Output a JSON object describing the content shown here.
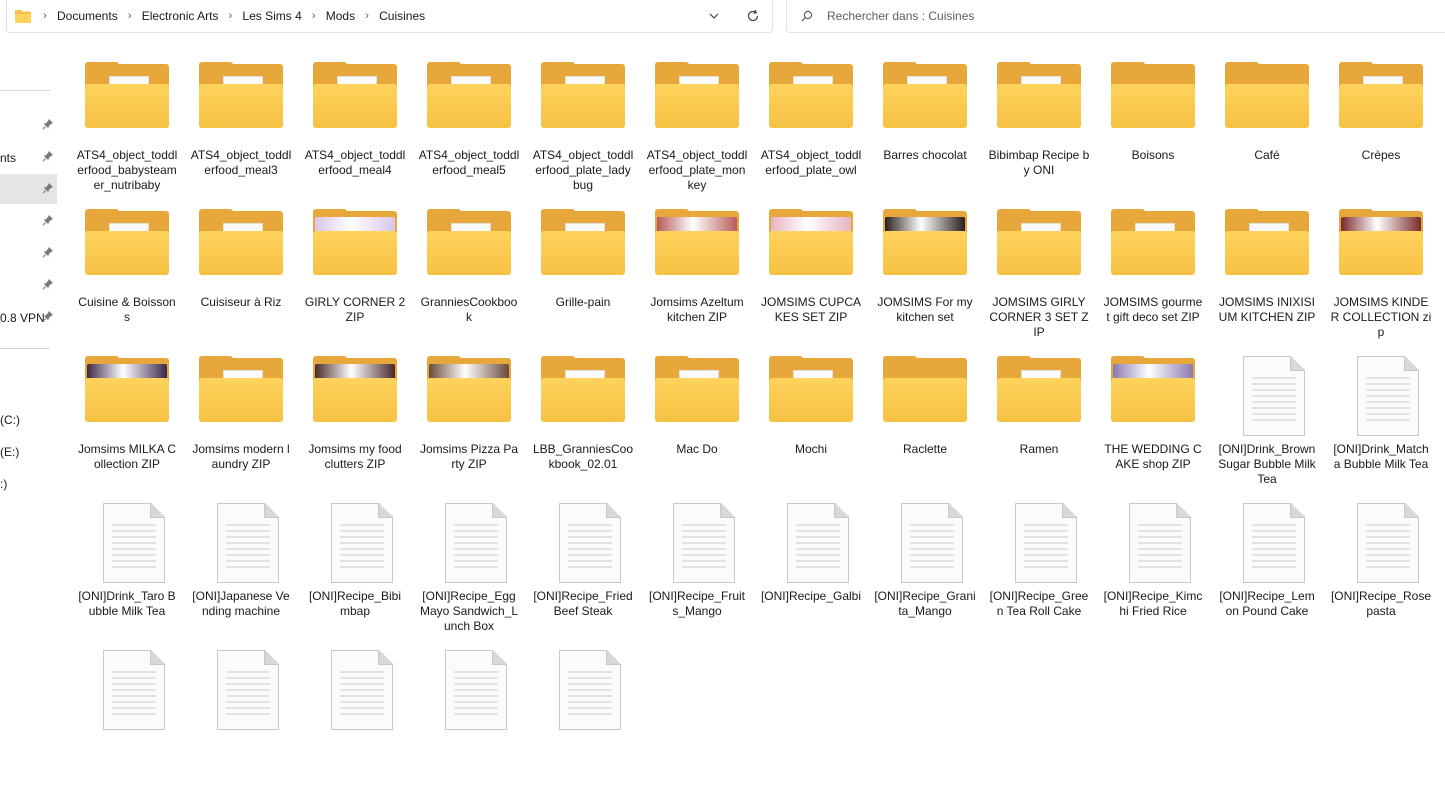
{
  "addressbar": {
    "crumbs": [
      "Documents",
      "Electronic Arts",
      "Les Sims 4",
      "Mods",
      "Cuisines"
    ]
  },
  "search": {
    "placeholder": "Rechercher dans : Cuisines"
  },
  "nav": {
    "items": [
      {
        "label": "",
        "pinned": true
      },
      {
        "label": "nts",
        "pinned": true
      },
      {
        "label": "",
        "pinned": true,
        "selected": true
      },
      {
        "label": "",
        "pinned": true
      },
      {
        "label": "",
        "pinned": true
      },
      {
        "label": "",
        "pinned": true
      },
      {
        "label": "0.8 VPN",
        "pinned": true
      }
    ],
    "drives": [
      "(C:)",
      "(E:)",
      ":)"
    ]
  },
  "colors": {
    "folder_front": "#f5c143",
    "folder_back": "#e8a73a",
    "selected_nav": "#e5e5e5"
  },
  "items": [
    {
      "name": "ATS4_object_toddlerfood_babysteamer_nutribaby",
      "kind": "folder"
    },
    {
      "name": "ATS4_object_toddlerfood_meal3",
      "kind": "folder"
    },
    {
      "name": "ATS4_object_toddlerfood_meal4",
      "kind": "folder"
    },
    {
      "name": "ATS4_object_toddlerfood_meal5",
      "kind": "folder"
    },
    {
      "name": "ATS4_object_toddlerfood_plate_ladybug",
      "kind": "folder"
    },
    {
      "name": "ATS4_object_toddlerfood_plate_monkey",
      "kind": "folder"
    },
    {
      "name": "ATS4_object_toddlerfood_plate_owl",
      "kind": "folder"
    },
    {
      "name": "Barres chocolat",
      "kind": "folder"
    },
    {
      "name": "Bibimbap Recipe by ONI",
      "kind": "folder"
    },
    {
      "name": "Boisons",
      "kind": "folder-empty"
    },
    {
      "name": "Café",
      "kind": "folder-empty"
    },
    {
      "name": "Crèpes",
      "kind": "folder"
    },
    {
      "name": "Cuisine & Boissons",
      "kind": "folder"
    },
    {
      "name": "Cuisiseur à Riz",
      "kind": "folder"
    },
    {
      "name": "GIRLY CORNER 2 ZIP",
      "kind": "folder-image",
      "image": "#d9c5e8"
    },
    {
      "name": "GranniesCookbook",
      "kind": "folder"
    },
    {
      "name": "Grille-pain",
      "kind": "folder"
    },
    {
      "name": "Jomsims Azeltum kitchen ZIP",
      "kind": "folder-image",
      "image": "#b85b5b"
    },
    {
      "name": "JOMSIMS CUPCAKES SET ZIP",
      "kind": "folder-image",
      "image": "#e7b4c4"
    },
    {
      "name": "JOMSIMS For my kitchen set",
      "kind": "folder-image",
      "image": "#2b1e1e"
    },
    {
      "name": "JOMSIMS GIRLY CORNER 3 SET ZIP",
      "kind": "folder"
    },
    {
      "name": "JOMSIMS gourmet gift deco set ZIP",
      "kind": "folder"
    },
    {
      "name": "JOMSIMS INIXISIUM KITCHEN ZIP",
      "kind": "folder"
    },
    {
      "name": "JOMSIMS KINDER COLLECTION zip",
      "kind": "folder-image",
      "image": "#7a2a2a"
    },
    {
      "name": "Jomsims MILKA Collection ZIP",
      "kind": "folder-image",
      "image": "#3a2848"
    },
    {
      "name": "Jomsims modern laundry ZIP",
      "kind": "folder"
    },
    {
      "name": "Jomsims my food clutters ZIP",
      "kind": "folder-image",
      "image": "#4a2a2a"
    },
    {
      "name": "Jomsims Pizza Party ZIP",
      "kind": "folder-image",
      "image": "#6a4a3a"
    },
    {
      "name": "LBB_GranniesCookbook_02.01",
      "kind": "folder"
    },
    {
      "name": "Mac Do",
      "kind": "folder"
    },
    {
      "name": "Mochi",
      "kind": "folder"
    },
    {
      "name": "Raclette",
      "kind": "folder-empty"
    },
    {
      "name": "Ramen",
      "kind": "folder"
    },
    {
      "name": "THE WEDDING CAKE shop  ZIP",
      "kind": "folder-image",
      "image": "#8a7ab0"
    },
    {
      "name": "[ONI]Drink_Brown Sugar Bubble Milk Tea",
      "kind": "file"
    },
    {
      "name": "[ONI]Drink_Matcha Bubble Milk Tea",
      "kind": "file"
    },
    {
      "name": "[ONI]Drink_Taro Bubble Milk Tea",
      "kind": "file"
    },
    {
      "name": "[ONI]Japanese Vending machine",
      "kind": "file"
    },
    {
      "name": "[ONI]Recipe_Bibimbap",
      "kind": "file"
    },
    {
      "name": "[ONI]Recipe_Egg Mayo Sandwich_Lunch Box",
      "kind": "file"
    },
    {
      "name": "[ONI]Recipe_Fried Beef Steak",
      "kind": "file"
    },
    {
      "name": "[ONI]Recipe_Fruits_Mango",
      "kind": "file"
    },
    {
      "name": "[ONI]Recipe_Galbi",
      "kind": "file"
    },
    {
      "name": "[ONI]Recipe_Granita_Mango",
      "kind": "file"
    },
    {
      "name": "[ONI]Recipe_Green Tea Roll Cake",
      "kind": "file"
    },
    {
      "name": "[ONI]Recipe_Kimchi Fried Rice",
      "kind": "file"
    },
    {
      "name": "[ONI]Recipe_Lemon Pound Cake",
      "kind": "file"
    },
    {
      "name": "[ONI]Recipe_Rose pasta",
      "kind": "file"
    },
    {
      "name": "",
      "kind": "file"
    },
    {
      "name": "",
      "kind": "file"
    },
    {
      "name": "",
      "kind": "file"
    },
    {
      "name": "",
      "kind": "file"
    },
    {
      "name": "",
      "kind": "file"
    }
  ]
}
